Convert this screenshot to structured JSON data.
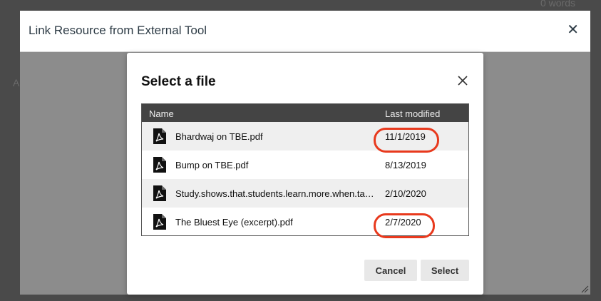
{
  "backdrop": {
    "word_count": "0 words",
    "left_fragment": "A"
  },
  "outer_dialog": {
    "title": "Link Resource from External Tool",
    "close_glyph": "✕"
  },
  "modal": {
    "title": "Select a file",
    "table": {
      "columns": [
        "Name",
        "Last modified"
      ],
      "rows": [
        {
          "name": "Bhardwaj on TBE.pdf",
          "modified": "11/1/2019",
          "icon": "pdf-file-icon",
          "highlighted": true
        },
        {
          "name": "Bump on TBE.pdf",
          "modified": "8/13/2019",
          "icon": "pdf-file-icon",
          "highlighted": false
        },
        {
          "name": "Study.shows.that.students.learn.more.when.ta…",
          "modified": "2/10/2020",
          "icon": "pdf-file-icon",
          "highlighted": false
        },
        {
          "name": "The Bluest Eye (excerpt).pdf",
          "modified": "2/7/2020",
          "icon": "pdf-file-icon",
          "highlighted": true
        }
      ]
    },
    "buttons": {
      "cancel": "Cancel",
      "select": "Select"
    }
  },
  "colors": {
    "table_header_bg": "#444444",
    "highlight_circle": "#e8391d",
    "overlay_gray": "#8c8c8c"
  }
}
